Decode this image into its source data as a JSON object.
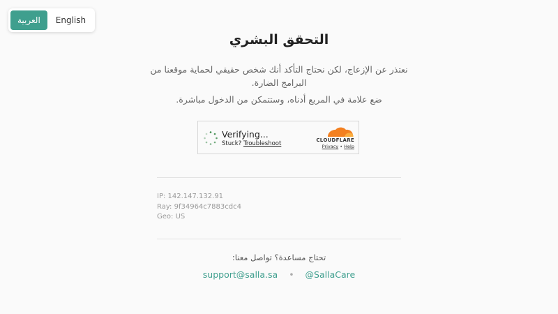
{
  "language_switcher": {
    "arabic_label": "العربية",
    "english_label": "English"
  },
  "title": "التحقق البشري",
  "description": "نعتذر عن الإزعاج، لكن نحتاج التأكد أنك شخص حقيقي لحماية موقعنا من البرامج الضارة.",
  "instruction": "ضع علامة في المربع أدناه، وستتمكن من الدخول مباشرة.",
  "captcha": {
    "status": "Verifying...",
    "stuck_label": "Stuck?",
    "troubleshoot_label": "Troubleshoot",
    "brand": "CLOUDFLARE",
    "privacy_label": "Privacy",
    "link_separator": "•",
    "help_label": "Help",
    "brand_color": "#f38020"
  },
  "info": {
    "ip": "IP: 142.147.132.91",
    "ray": "Ray: 9f34964c7883cdc4",
    "geo": "Geo: US"
  },
  "help": {
    "prompt": "تحتاج مساعدة؟ تواصل معنا:",
    "email": "support@salla.sa",
    "separator": "•",
    "handle": "@SallaCare"
  },
  "colors": {
    "accent": "#3f9f8e",
    "background": "#fafafa"
  }
}
